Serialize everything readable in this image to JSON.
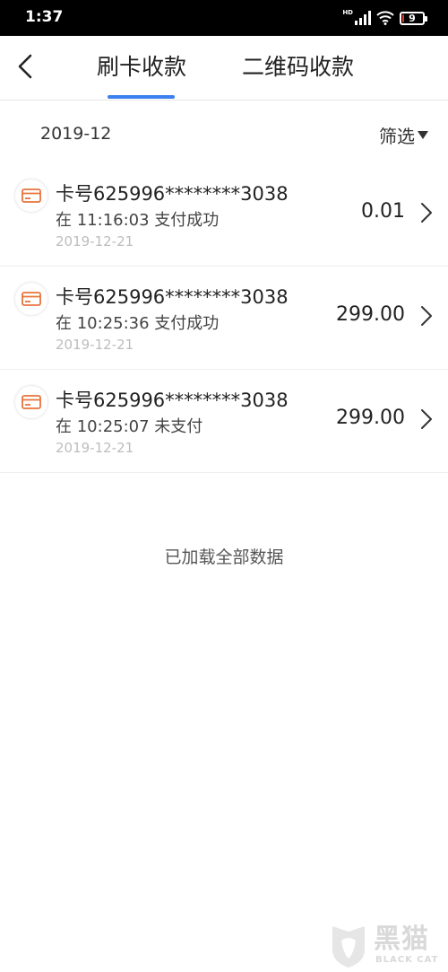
{
  "status_bar": {
    "time": "1:37",
    "network": "HD",
    "battery_level": "9",
    "battery_fraction": 0.09
  },
  "tabs": [
    {
      "label": "刷卡收款",
      "active": true
    },
    {
      "label": "二维码收款",
      "active": false
    }
  ],
  "filter_bar": {
    "month": "2019-12",
    "filter_label": "筛选"
  },
  "records": [
    {
      "card": "卡号625996********3038",
      "status": "在 11:16:03  支付成功",
      "date": "2019-12-21",
      "amount": "0.01"
    },
    {
      "card": "卡号625996********3038",
      "status": "在 10:25:36  支付成功",
      "date": "2019-12-21",
      "amount": "299.00"
    },
    {
      "card": "卡号625996********3038",
      "status": "在 10:25:07  未支付",
      "date": "2019-12-21",
      "amount": "299.00"
    }
  ],
  "footer_text": "已加载全部数据",
  "watermark": {
    "text": "黑猫",
    "subtext": "BLACK CAT"
  },
  "colors": {
    "accent": "#3c7ff0",
    "card_icon": "#e8743b",
    "battery_low": "#e3342f"
  },
  "icons": [
    "back-arrow-icon",
    "bank-card-icon",
    "chevron-right-icon",
    "filter-dropdown-icon",
    "signal-icon",
    "wifi-icon",
    "battery-icon"
  ]
}
